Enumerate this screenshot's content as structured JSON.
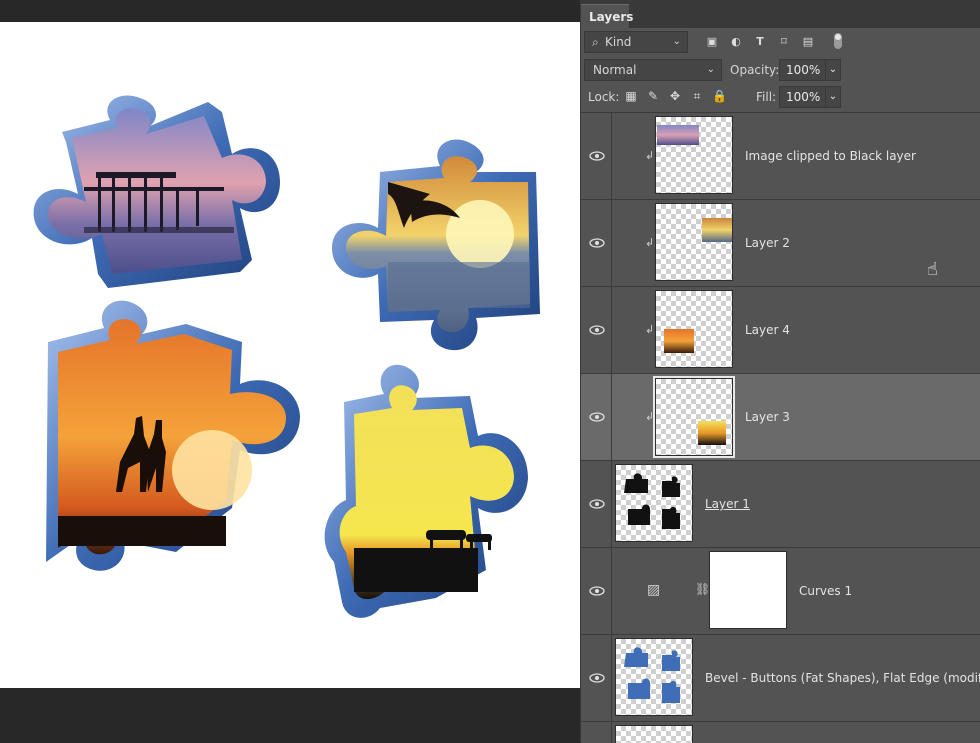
{
  "panel": {
    "tab_label": "Layers",
    "filter": {
      "kind_label": "Kind",
      "filter_icons": [
        "image-filter-icon",
        "adjustment-filter-icon",
        "type-filter-icon",
        "shape-filter-icon",
        "smart-object-filter-icon"
      ]
    },
    "blend_mode": "Normal",
    "opacity_label": "Opacity:",
    "opacity_value": "100%",
    "lock_label": "Lock:",
    "fill_label": "Fill:",
    "fill_value": "100%"
  },
  "layers": [
    {
      "name": "Image clipped to Black layer",
      "clipped": true,
      "selected": false
    },
    {
      "name": "Layer 2",
      "clipped": true,
      "selected": false
    },
    {
      "name": "Layer 4",
      "clipped": true,
      "selected": false
    },
    {
      "name": "Layer 3",
      "clipped": true,
      "selected": true
    },
    {
      "name": "Layer 1",
      "clipped": false,
      "selected": false
    },
    {
      "name": "Curves 1",
      "clipped": false,
      "selected": false,
      "adjustment": true
    },
    {
      "name": "Bevel - Buttons (Fat Shapes), Flat Edge (modifi...",
      "clipped": false,
      "selected": false
    }
  ],
  "colors": {
    "panel_bg": "#535353",
    "selected_row": "#6a6a6a",
    "puzzle_blue": "#3f6db7"
  }
}
